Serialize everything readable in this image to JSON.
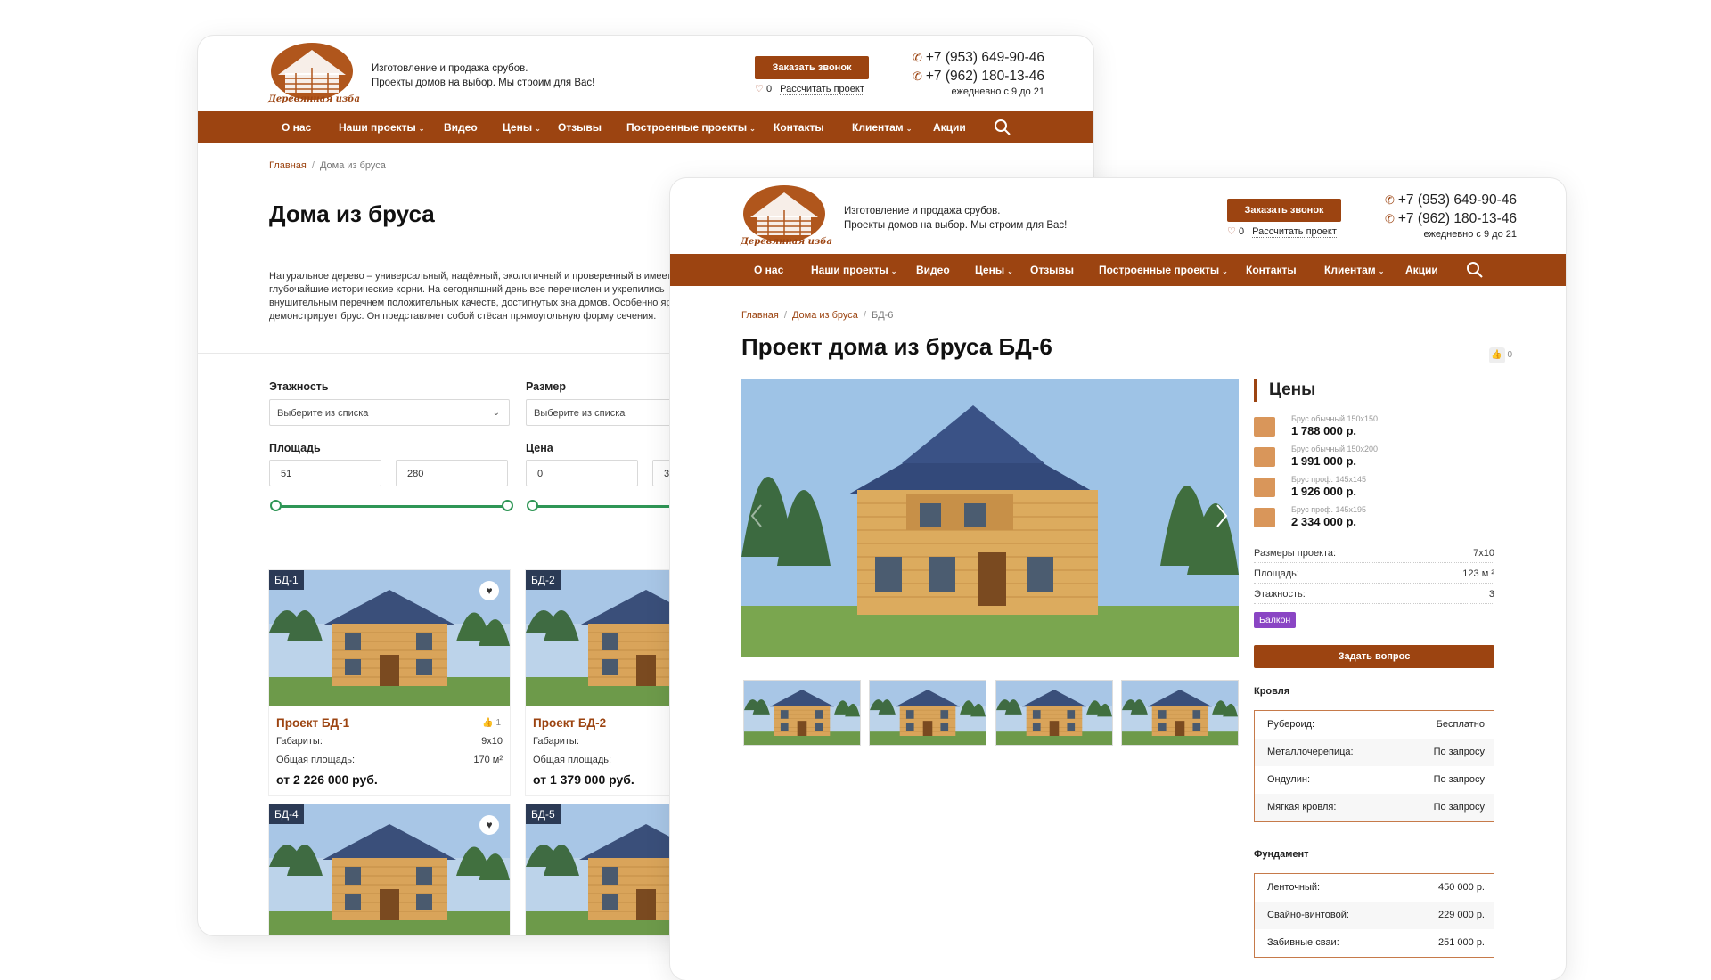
{
  "brand": {
    "caption": "Деревянная изба",
    "tagline_1": "Изготовление и продажа срубов.",
    "tagline_2": "Проекты домов на выбор. Мы строим для Вас!",
    "colors": {
      "accent": "#9c4411",
      "slider": "#2f9656",
      "badge_bg": "#2b3a55",
      "balcony_tag": "#8a45c4"
    }
  },
  "header": {
    "call_button": "Заказать звонок",
    "fav_count": "0",
    "calc_link": "Рассчитать проект",
    "phone_1": "+7 (953) 649-90-46",
    "phone_2": "+7 (962) 180-13-46",
    "hours": "ежедневно с 9 до 21"
  },
  "nav": {
    "items": [
      "О нас",
      "Наши проекты",
      "Видео",
      "Цены",
      "Отзывы",
      "Построенные проекты",
      "Контакты",
      "Клиентам",
      "Акции"
    ],
    "search_icon": "search-icon"
  },
  "catalog": {
    "breadcrumb_home": "Главная",
    "breadcrumb_current": "Дома из бруса",
    "title": "Дома из бруса",
    "intro": "Натуральное дерево – универсальный, надёжный, экологичный и проверенный в имеет глубочайшие исторические корни. На сегодняшний день все перечислен и укрепились внушительным перечнем положительных качеств, достигнутых зна домов. Особенно ярко всё это демонстрирует брус. Он представляет собой стёсан прямоугольную форму сечения.",
    "filters": {
      "floors_label": "Этажность",
      "floors_placeholder": "Выберите из списка",
      "size_label": "Размер",
      "size_placeholder": "Выберите из списка",
      "area_label": "Площадь",
      "area_min": "51",
      "area_max": "280",
      "price_label": "Цена",
      "price_min": "0",
      "price_max_partial": "3"
    },
    "cards": [
      {
        "badge": "БД-1",
        "title": "Проект БД-1",
        "likes": "1",
        "dims_label": "Габариты:",
        "dims": "9x10",
        "area_label": "Общая площадь:",
        "area": "170 м²",
        "price": "от 2 226 000 руб."
      },
      {
        "badge": "БД-2",
        "title": "Проект БД-2",
        "dims_label": "Габариты:",
        "area_label": "Общая площадь:",
        "price": "от 1 379 000 руб."
      },
      {
        "badge": "БД-4"
      },
      {
        "badge": "БД-5"
      }
    ]
  },
  "project": {
    "breadcrumb_home": "Главная",
    "breadcrumb_section": "Дома из бруса",
    "breadcrumb_current": "БД-6",
    "title": "Проект дома из бруса БД-6",
    "likes": "0",
    "prices_title": "Цены",
    "prices": [
      {
        "label": "Брус обычный 150x150",
        "value": "1 788 000 р."
      },
      {
        "label": "Брус обычный 150x200",
        "value": "1 991 000 р."
      },
      {
        "label": "Брус проф. 145x145",
        "value": "1 926 000 р."
      },
      {
        "label": "Брус проф. 145x195",
        "value": "2 334 000 р."
      }
    ],
    "specs": [
      {
        "key": "Размеры проекта:",
        "value": "7x10"
      },
      {
        "key": "Площадь:",
        "value": "123 м ²"
      },
      {
        "key": "Этажность:",
        "value": "3"
      }
    ],
    "tag": "Балкон",
    "ask_button": "Задать вопрос",
    "roof_label": "Кровля",
    "roof": [
      {
        "name": "Рубероид:",
        "value": "Бесплатно"
      },
      {
        "name": "Металлочерепица:",
        "value": "По запросу"
      },
      {
        "name": "Ондулин:",
        "value": "По запросу"
      },
      {
        "name": "Мягкая кровля:",
        "value": "По запросу"
      }
    ],
    "foundation_label": "Фундамент",
    "foundation": [
      {
        "name": "Ленточный:",
        "value": "450 000 р."
      },
      {
        "name": "Свайно-винтовой:",
        "value": "229 000 р."
      },
      {
        "name": "Забивные сваи:",
        "value": "251 000 р."
      }
    ]
  }
}
